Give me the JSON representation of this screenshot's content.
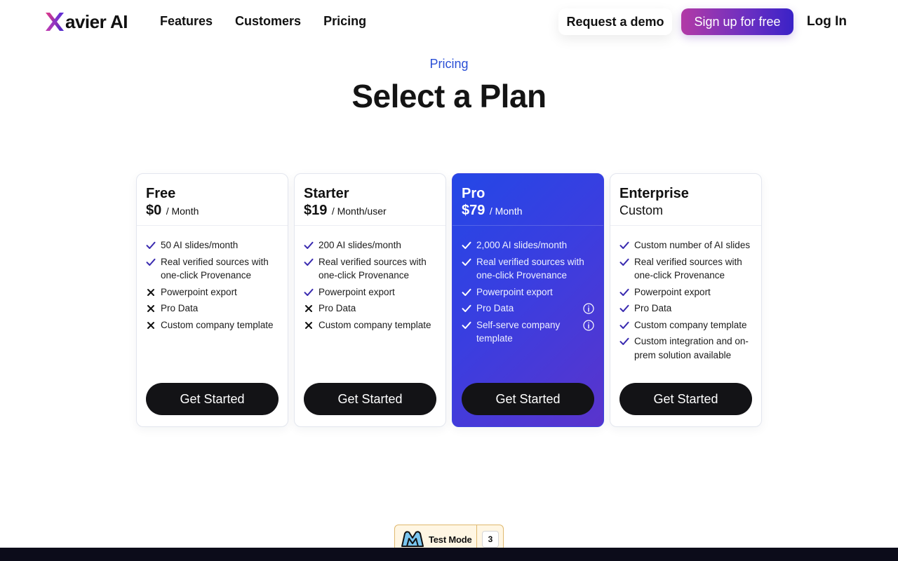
{
  "nav": {
    "logo_text": "avier AI",
    "links": [
      "Features",
      "Customers",
      "Pricing"
    ],
    "request_demo": "Request a demo",
    "sign_up": "Sign up for free",
    "log_in": "Log In"
  },
  "header": {
    "eyebrow": "Pricing",
    "title": "Select a Plan"
  },
  "plans": [
    {
      "name": "Free",
      "price": "$0",
      "unit": "/ Month",
      "features": [
        {
          "text": "50 AI slides/month",
          "included": true
        },
        {
          "text": "Real verified sources with one-click Provenance",
          "included": true
        },
        {
          "text": "Powerpoint export",
          "included": false
        },
        {
          "text": "Pro Data",
          "included": false
        },
        {
          "text": "Custom company template",
          "included": false
        }
      ],
      "cta": "Get Started"
    },
    {
      "name": "Starter",
      "price": "$19",
      "unit": "/ Month/user",
      "features": [
        {
          "text": "200 AI slides/month",
          "included": true
        },
        {
          "text": "Real verified sources with one-click Provenance",
          "included": true
        },
        {
          "text": "Powerpoint export",
          "included": true
        },
        {
          "text": "Pro Data",
          "included": false
        },
        {
          "text": "Custom company template",
          "included": false
        }
      ],
      "cta": "Get Started"
    },
    {
      "name": "Pro",
      "price": "$79",
      "unit": "/ Month",
      "features": [
        {
          "text": "2,000 AI slides/month",
          "included": true
        },
        {
          "text": "Real verified sources with one-click Provenance",
          "included": true
        },
        {
          "text": "Powerpoint export",
          "included": true
        },
        {
          "text": "Pro Data",
          "included": true,
          "info": true
        },
        {
          "text": "Self-serve company template",
          "included": true,
          "info": true
        }
      ],
      "cta": "Get Started"
    },
    {
      "name": "Enterprise",
      "price_text": "Custom",
      "features": [
        {
          "text": "Custom number of AI slides",
          "included": true
        },
        {
          "text": "Real verified sources with one-click Provenance",
          "included": true
        },
        {
          "text": "Powerpoint export",
          "included": true
        },
        {
          "text": "Pro Data",
          "included": true
        },
        {
          "text": "Custom company template",
          "included": true
        },
        {
          "text": "Custom integration and on-prem solution available",
          "included": true
        }
      ],
      "cta": "Get Started"
    }
  ],
  "test_mode": {
    "label": "Test Mode",
    "count": "3"
  },
  "colors": {
    "accent_blue": "#2a4fd6",
    "check_color": "#3a2bb0",
    "pro_card": "#3a3ee0",
    "button_dark": "#131316"
  }
}
